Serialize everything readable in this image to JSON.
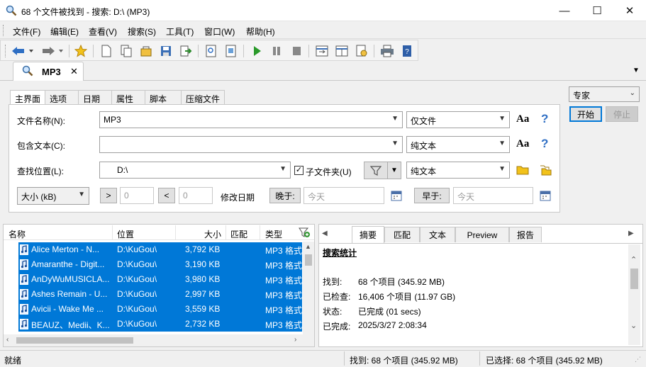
{
  "window": {
    "title": "68 个文件被找到 - 搜索: D:\\ (MP3)"
  },
  "menu": [
    "文件(F)",
    "编辑(E)",
    "查看(V)",
    "搜索(S)",
    "工具(T)",
    "窗口(W)",
    "帮助(H)"
  ],
  "doc_tab": {
    "label": "MP3"
  },
  "search_tabs": [
    "主界面",
    "选项",
    "日期",
    "属性",
    "脚本",
    "压缩文件"
  ],
  "form": {
    "filename_label": "文件名称(N):",
    "filename_value": "MP3",
    "filename_mode": "仅文件",
    "content_label": "包含文本(C):",
    "content_value": "",
    "content_mode": "纯文本",
    "location_label": "查找位置(L):",
    "location_value": "D:\\",
    "subfolders_label": "子文件夹(U)",
    "location_mode": "纯文本",
    "size_select": "大小 (kB)",
    "gt_label": ">",
    "gt_value": "0",
    "lt_label": "<",
    "lt_value": "0",
    "date_label": "修改日期",
    "after_label": "晚于:",
    "after_value": "今天",
    "before_label": "早于:",
    "before_value": "今天",
    "aa_label": "Aa",
    "help_label": "?"
  },
  "side": {
    "mode": "专家",
    "start": "开始",
    "stop": "停止"
  },
  "results": {
    "columns": [
      "名称",
      "位置",
      "大小",
      "匹配",
      "类型"
    ],
    "rows": [
      {
        "name": "Alice Merton - N...",
        "loc": "D:\\KuGou\\",
        "size": "3,792 KB",
        "type": "MP3 格式"
      },
      {
        "name": "Amaranthe - Digit...",
        "loc": "D:\\KuGou\\",
        "size": "3,190 KB",
        "type": "MP3 格式"
      },
      {
        "name": "AnDyWuMUSICLA...",
        "loc": "D:\\KuGou\\",
        "size": "3,980 KB",
        "type": "MP3 格式"
      },
      {
        "name": "Ashes Remain - U...",
        "loc": "D:\\KuGou\\",
        "size": "2,997 KB",
        "type": "MP3 格式"
      },
      {
        "name": "Avicii - Wake Me ...",
        "loc": "D:\\KuGou\\",
        "size": "3,559 KB",
        "type": "MP3 格式"
      },
      {
        "name": "BEAUZ、Medii、K...",
        "loc": "D:\\KuGou\\",
        "size": "2,732 KB",
        "type": "MP3 格式"
      }
    ]
  },
  "right": {
    "tabs": [
      "摘要",
      "匹配",
      "文本",
      "Preview",
      "报告"
    ],
    "heading": "搜索统计",
    "stats": [
      {
        "k": "找到:",
        "v": "68 个项目 (345.92 MB)"
      },
      {
        "k": "已检查:",
        "v": "16,406 个项目 (11.97 GB)"
      },
      {
        "k": "状态:",
        "v": "已完成 (01 secs)"
      },
      {
        "k": "已完成:",
        "v": "2025/3/27 2:08:34"
      }
    ]
  },
  "status": {
    "left": "就绪",
    "found": "找到: 68 个项目 (345.92 MB)",
    "selected": "已选择: 68 个项目 (345.92 MB)"
  }
}
